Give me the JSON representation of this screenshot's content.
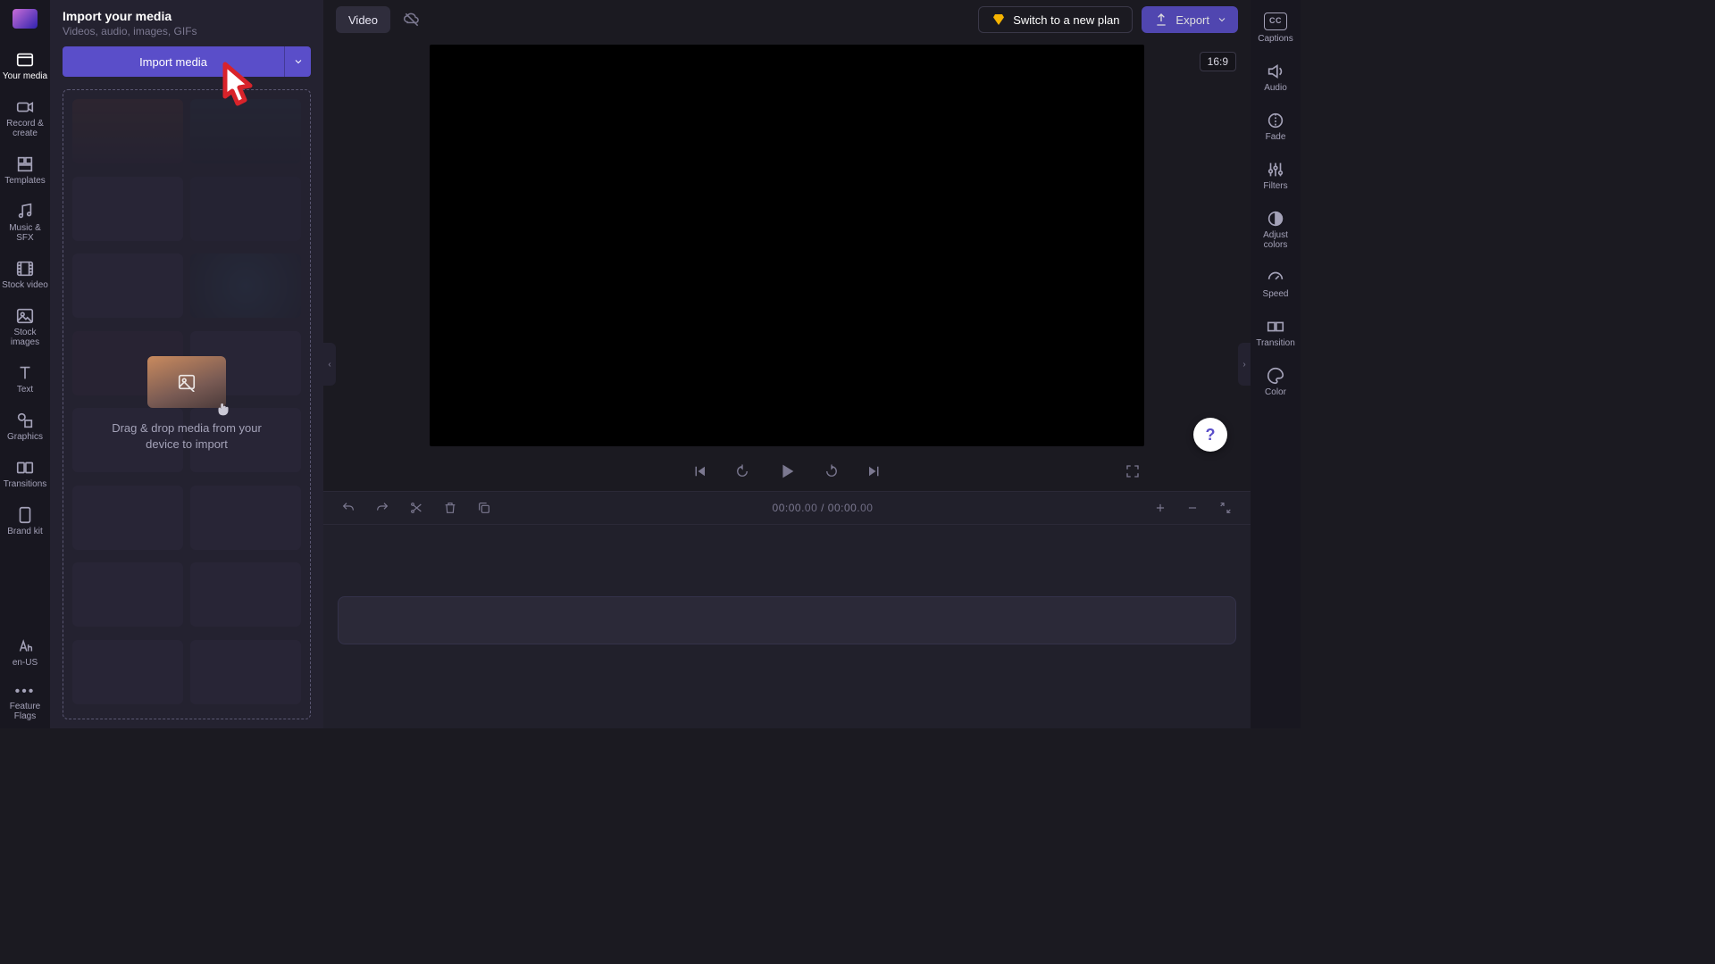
{
  "sidebar_left": {
    "items": [
      {
        "label": "Your media"
      },
      {
        "label": "Record &\ncreate"
      },
      {
        "label": "Templates"
      },
      {
        "label": "Music & SFX"
      },
      {
        "label": "Stock video"
      },
      {
        "label": "Stock\nimages"
      },
      {
        "label": "Text"
      },
      {
        "label": "Graphics"
      },
      {
        "label": "Transitions"
      },
      {
        "label": "Brand kit"
      }
    ],
    "locale_label": "en-US",
    "feature_flags_label": "Feature\nFlags"
  },
  "media_panel": {
    "title": "Import your media",
    "subtitle": "Videos, audio, images, GIFs",
    "import_button": "Import media",
    "drop_text": "Drag & drop media from your device to import"
  },
  "topbar": {
    "video_button": "Video",
    "upgrade_button": "Switch to a new plan",
    "export_button": "Export"
  },
  "preview": {
    "aspect_label": "16:9"
  },
  "timeline": {
    "current": "00:00",
    "current_frac": ".00",
    "total": "00:00",
    "total_frac": ".00",
    "separator": " / "
  },
  "sidebar_right": {
    "items": [
      {
        "label": "Captions"
      },
      {
        "label": "Audio"
      },
      {
        "label": "Fade"
      },
      {
        "label": "Filters"
      },
      {
        "label": "Adjust\ncolors"
      },
      {
        "label": "Speed"
      },
      {
        "label": "Transition"
      },
      {
        "label": "Color"
      }
    ]
  },
  "help_fab": "?"
}
